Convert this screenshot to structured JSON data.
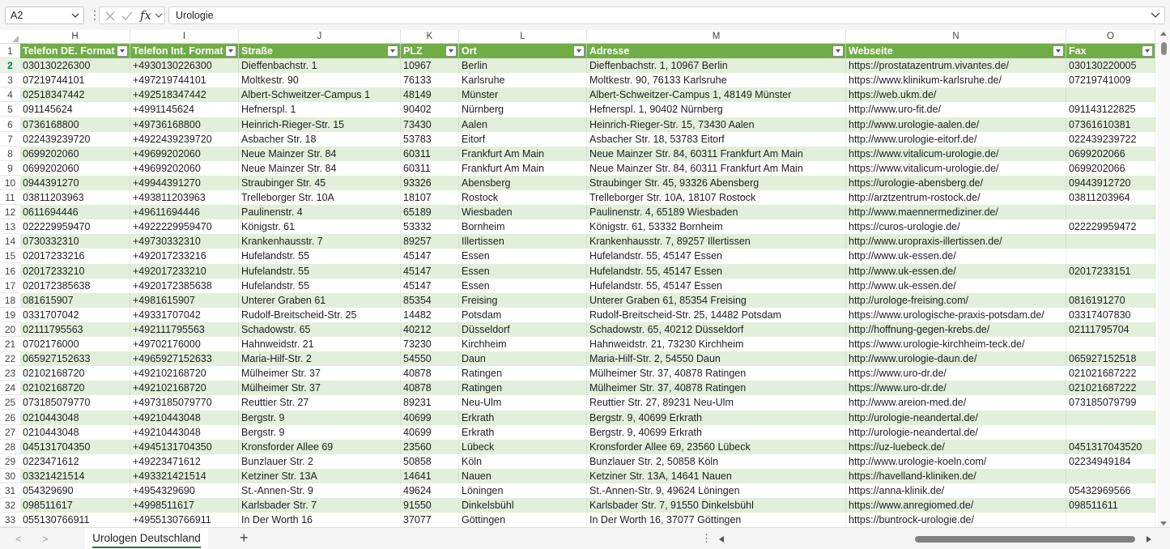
{
  "formula_bar": {
    "name_box": "A2",
    "fx_label": "fx",
    "formula_value": "Urologie",
    "more_dots": "⋮"
  },
  "columns": [
    "H",
    "I",
    "J",
    "K",
    "L",
    "M",
    "N",
    "O"
  ],
  "table_headers": [
    "Telefon DE. Format",
    "Telefon Int. Format",
    "Straße",
    "PLZ",
    "Ort",
    "Adresse",
    "Webseite",
    "Fax"
  ],
  "rows": [
    {
      "n": "2",
      "c": [
        "030130226300",
        "+4930130226300",
        "Dieffenbachstr. 1",
        "10967",
        "Berlin",
        "Dieffenbachstr. 1, 10967 Berlin",
        "https://prostatazentrum.vivantes.de/",
        "030130220005"
      ]
    },
    {
      "n": "3",
      "c": [
        "07219744101",
        "+497219744101",
        "Moltkestr. 90",
        "76133",
        "Karlsruhe",
        "Moltkestr. 90, 76133 Karlsruhe",
        "https://www.klinikum-karlsruhe.de/",
        "07219741009"
      ]
    },
    {
      "n": "4",
      "c": [
        "02518347442",
        "+492518347442",
        "Albert-Schweitzer-Campus 1",
        "48149",
        "Münster",
        "Albert-Schweitzer-Campus 1, 48149 Münster",
        "https://web.ukm.de/",
        ""
      ]
    },
    {
      "n": "5",
      "c": [
        "091145624",
        "+4991145624",
        "Hefnerspl. 1",
        "90402",
        "Nürnberg",
        "Hefnerspl. 1, 90402 Nürnberg",
        "http://www.uro-fit.de/",
        "091143122825"
      ]
    },
    {
      "n": "6",
      "c": [
        "0736168800",
        "+49736168800",
        "Heinrich-Rieger-Str. 15",
        "73430",
        "Aalen",
        "Heinrich-Rieger-Str. 15, 73430 Aalen",
        "http://www.urologie-aalen.de/",
        "07361610381"
      ]
    },
    {
      "n": "7",
      "c": [
        "022439239720",
        "+4922439239720",
        "Asbacher Str. 18",
        "53783",
        "Eitorf",
        "Asbacher Str. 18, 53783 Eitorf",
        "http://www.urologie-eitorf.de/",
        "022439239722"
      ]
    },
    {
      "n": "8",
      "c": [
        "0699202060",
        "+49699202060",
        "Neue Mainzer Str. 84",
        "60311",
        "Frankfurt Am Main",
        "Neue Mainzer Str. 84, 60311 Frankfurt Am Main",
        "https://www.vitalicum-urologie.de/",
        "0699202066"
      ]
    },
    {
      "n": "9",
      "c": [
        "0699202060",
        "+49699202060",
        "Neue Mainzer Str. 84",
        "60311",
        "Frankfurt Am Main",
        "Neue Mainzer Str. 84, 60311 Frankfurt Am Main",
        "https://www.vitalicum-urologie.de/",
        "0699202066"
      ]
    },
    {
      "n": "10",
      "c": [
        "0944391270",
        "+49944391270",
        "Straubinger Str. 45",
        "93326",
        "Abensberg",
        "Straubinger Str. 45, 93326 Abensberg",
        "https://urologie-abensberg.de/",
        "09443912720"
      ]
    },
    {
      "n": "11",
      "c": [
        "03811203963",
        "+493811203963",
        "Trelleborger Str. 10A",
        "18107",
        "Rostock",
        "Trelleborger Str. 10A, 18107 Rostock",
        "http://arztzentrum-rostock.de/",
        "03811203964"
      ]
    },
    {
      "n": "12",
      "c": [
        "0611694446",
        "+49611694446",
        "Paulinenstr. 4",
        "65189",
        "Wiesbaden",
        "Paulinenstr. 4, 65189 Wiesbaden",
        "http://www.maennermediziner.de/",
        ""
      ]
    },
    {
      "n": "13",
      "c": [
        "022229959470",
        "+4922229959470",
        "Königstr. 61",
        "53332",
        "Bornheim",
        "Königstr. 61, 53332 Bornheim",
        "https://curos-urologie.de/",
        "022229959472"
      ]
    },
    {
      "n": "14",
      "c": [
        "0730332310",
        "+49730332310",
        "Krankenhausstr. 7",
        "89257",
        "Illertissen",
        "Krankenhausstr. 7, 89257 Illertissen",
        "http://www.uropraxis-illertissen.de/",
        ""
      ]
    },
    {
      "n": "15",
      "c": [
        "02017233216",
        "+492017233216",
        "Hufelandstr. 55",
        "45147",
        "Essen",
        "Hufelandstr. 55, 45147 Essen",
        "http://www.uk-essen.de/",
        ""
      ]
    },
    {
      "n": "16",
      "c": [
        "02017233210",
        "+492017233210",
        "Hufelandstr. 55",
        "45147",
        "Essen",
        "Hufelandstr. 55, 45147 Essen",
        "http://www.uk-essen.de/",
        "02017233151"
      ]
    },
    {
      "n": "17",
      "c": [
        "020172385638",
        "+4920172385638",
        "Hufelandstr. 55",
        "45147",
        "Essen",
        "Hufelandstr. 55, 45147 Essen",
        "http://www.uk-essen.de/",
        ""
      ]
    },
    {
      "n": "18",
      "c": [
        "081615907",
        "+4981615907",
        "Unterer Graben 61",
        "85354",
        "Freising",
        "Unterer Graben 61, 85354 Freising",
        "http://urologe-freising.com/",
        "0816191270"
      ]
    },
    {
      "n": "19",
      "c": [
        "0331707042",
        "+49331707042",
        "Rudolf-Breitscheid-Str. 25",
        "14482",
        "Potsdam",
        "Rudolf-Breitscheid-Str. 25, 14482 Potsdam",
        "https://www.urologische-praxis-potsdam.de/",
        "03317407830"
      ]
    },
    {
      "n": "20",
      "c": [
        "02111795563",
        "+492111795563",
        "Schadowstr. 65",
        "40212",
        "Düsseldorf",
        "Schadowstr. 65, 40212 Düsseldorf",
        "http://hoffnung-gegen-krebs.de/",
        "02111795704"
      ]
    },
    {
      "n": "21",
      "c": [
        "0702176000",
        "+49702176000",
        "Hahnweidstr. 21",
        "73230",
        "Kirchheim",
        "Hahnweidstr. 21, 73230 Kirchheim",
        "https://www.urologie-kirchheim-teck.de/",
        ""
      ]
    },
    {
      "n": "22",
      "c": [
        "065927152633",
        "+4965927152633",
        "Maria-Hilf-Str. 2",
        "54550",
        "Daun",
        "Maria-Hilf-Str. 2, 54550 Daun",
        "http://www.urologie-daun.de/",
        "065927152518"
      ]
    },
    {
      "n": "23",
      "c": [
        "02102168720",
        "+492102168720",
        "Mülheimer Str. 37",
        "40878",
        "Ratingen",
        "Mülheimer Str. 37, 40878 Ratingen",
        "https://www.uro-dr.de/",
        "021021687222"
      ]
    },
    {
      "n": "24",
      "c": [
        "02102168720",
        "+492102168720",
        "Mülheimer Str. 37",
        "40878",
        "Ratingen",
        "Mülheimer Str. 37, 40878 Ratingen",
        "https://www.uro-dr.de/",
        "021021687222"
      ]
    },
    {
      "n": "25",
      "c": [
        "073185079770",
        "+4973185079770",
        "Reuttier Str. 27",
        "89231",
        "Neu-Ulm",
        "Reuttier Str. 27, 89231 Neu-Ulm",
        "http://www.areion-med.de/",
        "073185079799"
      ]
    },
    {
      "n": "26",
      "c": [
        "0210443048",
        "+49210443048",
        "Bergstr. 9",
        "40699",
        "Erkrath",
        "Bergstr. 9, 40699 Erkrath",
        "http://urologie-neandertal.de/",
        ""
      ]
    },
    {
      "n": "27",
      "c": [
        "0210443048",
        "+49210443048",
        "Bergstr. 9",
        "40699",
        "Erkrath",
        "Bergstr. 9, 40699 Erkrath",
        "http://urologie-neandertal.de/",
        ""
      ]
    },
    {
      "n": "28",
      "c": [
        "045131704350",
        "+4945131704350",
        "Kronsforder Allee 69",
        "23560",
        "Lübeck",
        "Kronsforder Allee 69, 23560 Lübeck",
        "https://uz-luebeck.de/",
        "0451317043520"
      ]
    },
    {
      "n": "29",
      "c": [
        "0223471612",
        "+49223471612",
        "Bunzlauer Str. 2",
        "50858",
        "Köln",
        "Bunzlauer Str. 2, 50858 Köln",
        "http://www.urologie-koeln.com/",
        "02234949184"
      ]
    },
    {
      "n": "30",
      "c": [
        "03321421514",
        "+493321421514",
        "Ketziner Str. 13A",
        "14641",
        "Nauen",
        "Ketziner Str. 13A, 14641 Nauen",
        "https://havelland-kliniken.de/",
        ""
      ]
    },
    {
      "n": "31",
      "c": [
        "054329690",
        "+4954329690",
        "St.-Annen-Str. 9",
        "49624",
        "Löningen",
        "St.-Annen-Str. 9, 49624 Löningen",
        "https://anna-klinik.de/",
        "05432969566"
      ]
    },
    {
      "n": "32",
      "c": [
        "098511617",
        "+4998511617",
        "Karlsbader Str. 7",
        "91550",
        "Dinkelsbühl",
        "Karlsbader Str. 7, 91550 Dinkelsbühl",
        "https://www.anregiomed.de/",
        "098511611"
      ]
    },
    {
      "n": "33",
      "c": [
        "055130766911",
        "+4955130766911",
        "In Der Worth 16",
        "37077",
        "Göttingen",
        "In Der Worth 16, 37077 Göttingen",
        "https://buntrock-urologie.de/",
        ""
      ]
    }
  ],
  "sheet_tabs": {
    "active": "Urologen Deutschland",
    "prev": "<",
    "next": ">",
    "add": "+",
    "more": "⋮"
  },
  "colors": {
    "header_fill": "#70ad47",
    "band_fill": "#e2efda",
    "accent": "#107c41"
  }
}
